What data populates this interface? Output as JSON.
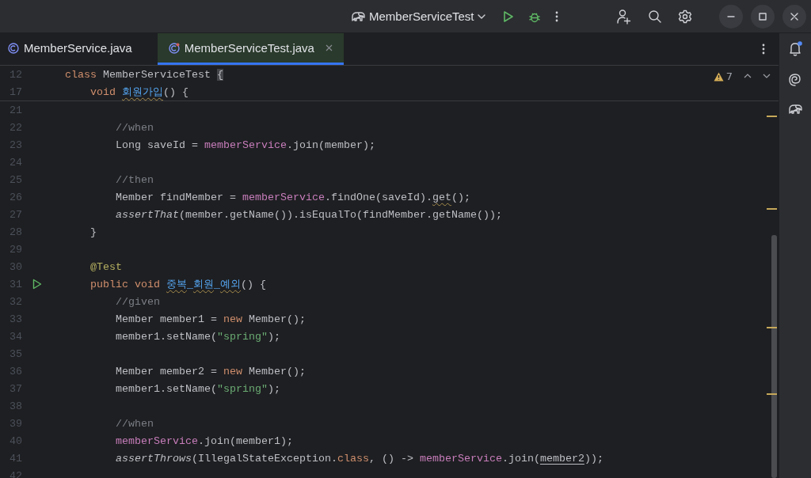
{
  "title_bar": {
    "run_configuration": "MemberServiceTest"
  },
  "tabs": [
    {
      "label": "MemberService.java",
      "selected": false
    },
    {
      "label": "MemberServiceTest.java",
      "selected": true
    }
  ],
  "inspections": {
    "warning_count": "7"
  },
  "sticky_lines": [
    {
      "number": "12",
      "tokens": [
        {
          "text": "class",
          "kind": "keyword"
        },
        {
          "text": " MemberServiceTest ",
          "kind": "plain"
        },
        {
          "text": "{",
          "kind": "brace-match"
        }
      ]
    },
    {
      "number": "17",
      "tokens": [
        {
          "text": "    void ",
          "kind": "keyword"
        },
        {
          "text": "회원가입",
          "kind": "declaration-warned"
        },
        {
          "text": "() {",
          "kind": "plain"
        }
      ]
    }
  ],
  "lines": [
    {
      "number": "21",
      "run": false
    },
    {
      "number": "22",
      "run": false,
      "tokens": [
        {
          "text": "        //when",
          "kind": "comment"
        }
      ]
    },
    {
      "number": "23",
      "run": false,
      "tokens": [
        {
          "text": "        Long saveId = ",
          "kind": "plain"
        },
        {
          "text": "memberService",
          "kind": "field"
        },
        {
          "text": ".join(member);",
          "kind": "plain"
        }
      ]
    },
    {
      "number": "24",
      "run": false
    },
    {
      "number": "25",
      "run": false,
      "tokens": [
        {
          "text": "        //then",
          "kind": "comment"
        }
      ]
    },
    {
      "number": "26",
      "run": false,
      "tokens": [
        {
          "text": "        Member findMember = ",
          "kind": "plain"
        },
        {
          "text": "memberService",
          "kind": "field"
        },
        {
          "text": ".findOne(saveId).",
          "kind": "plain"
        },
        {
          "text": "get",
          "kind": "warned"
        },
        {
          "text": "();",
          "kind": "plain"
        }
      ]
    },
    {
      "number": "27",
      "run": false,
      "tokens": [
        {
          "text": "        assertThat",
          "kind": "static-call"
        },
        {
          "text": "(member.getName()).isEqualTo(findMember.getName());",
          "kind": "plain"
        }
      ]
    },
    {
      "number": "28",
      "run": false,
      "tokens": [
        {
          "text": "    }",
          "kind": "plain"
        }
      ]
    },
    {
      "number": "29",
      "run": false
    },
    {
      "number": "30",
      "run": false,
      "tokens": [
        {
          "text": "    @Test",
          "kind": "annotation"
        }
      ]
    },
    {
      "number": "31",
      "run": true,
      "tokens": [
        {
          "text": "    public void ",
          "kind": "keyword"
        },
        {
          "text": "중복",
          "kind": "declaration-warned"
        },
        {
          "text": "_",
          "kind": "declaration"
        },
        {
          "text": "회원",
          "kind": "declaration-warned"
        },
        {
          "text": "_",
          "kind": "declaration"
        },
        {
          "text": "예외",
          "kind": "declaration-warned"
        },
        {
          "text": "() {",
          "kind": "plain"
        }
      ]
    },
    {
      "number": "32",
      "run": false,
      "tokens": [
        {
          "text": "        //given",
          "kind": "comment"
        }
      ]
    },
    {
      "number": "33",
      "run": false,
      "tokens": [
        {
          "text": "        Member member1 = ",
          "kind": "plain"
        },
        {
          "text": "new",
          "kind": "keyword"
        },
        {
          "text": " Member();",
          "kind": "plain"
        }
      ]
    },
    {
      "number": "34",
      "run": false,
      "tokens": [
        {
          "text": "        member1.setName(",
          "kind": "plain"
        },
        {
          "text": "\"spring\"",
          "kind": "string"
        },
        {
          "text": ");",
          "kind": "plain"
        }
      ]
    },
    {
      "number": "35",
      "run": false
    },
    {
      "number": "36",
      "run": false,
      "tokens": [
        {
          "text": "        Member member2 = ",
          "kind": "plain"
        },
        {
          "text": "new",
          "kind": "keyword"
        },
        {
          "text": " Member();",
          "kind": "plain"
        }
      ]
    },
    {
      "number": "37",
      "run": false,
      "tokens": [
        {
          "text": "        member1.setName(",
          "kind": "plain"
        },
        {
          "text": "\"spring\"",
          "kind": "string"
        },
        {
          "text": ");",
          "kind": "plain"
        }
      ]
    },
    {
      "number": "38",
      "run": false
    },
    {
      "number": "39",
      "run": false,
      "tokens": [
        {
          "text": "        //when",
          "kind": "comment"
        }
      ]
    },
    {
      "number": "40",
      "run": false,
      "tokens": [
        {
          "text": "        memberService",
          "kind": "field"
        },
        {
          "text": ".join(member1);",
          "kind": "plain"
        }
      ]
    },
    {
      "number": "41",
      "run": false,
      "tokens": [
        {
          "text": "        assertThrows",
          "kind": "static-call"
        },
        {
          "text": "(IllegalStateException.",
          "kind": "plain"
        },
        {
          "text": "class",
          "kind": "keyword"
        },
        {
          "text": ", () -> ",
          "kind": "plain"
        },
        {
          "text": "memberService",
          "kind": "field"
        },
        {
          "text": ".join(",
          "kind": "plain"
        },
        {
          "text": "member2",
          "kind": "reference"
        },
        {
          "text": "));",
          "kind": "plain"
        }
      ]
    },
    {
      "number": "42",
      "run": false
    }
  ]
}
